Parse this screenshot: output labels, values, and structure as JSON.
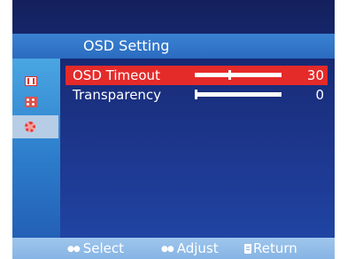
{
  "osd": {
    "title": "OSD Setting",
    "left_tabs": [
      {
        "icon": "monitor-icon"
      },
      {
        "icon": "color-icon"
      },
      {
        "icon": "gear-icon",
        "selected": true
      }
    ],
    "items": [
      {
        "label": "OSD Timeout",
        "value": "30",
        "level": 0.4,
        "selected": true
      },
      {
        "label": "Transparency",
        "value": "0",
        "level": 0.0,
        "selected": false
      }
    ],
    "footer": {
      "select_label": "Select",
      "adjust_label": "Adjust",
      "return_label": "Return"
    },
    "colors": {
      "selection": "#e52a2a",
      "title_bar": "#2a6cc0",
      "background": "#1a2f7e",
      "footer": "#9fc6ec"
    }
  }
}
